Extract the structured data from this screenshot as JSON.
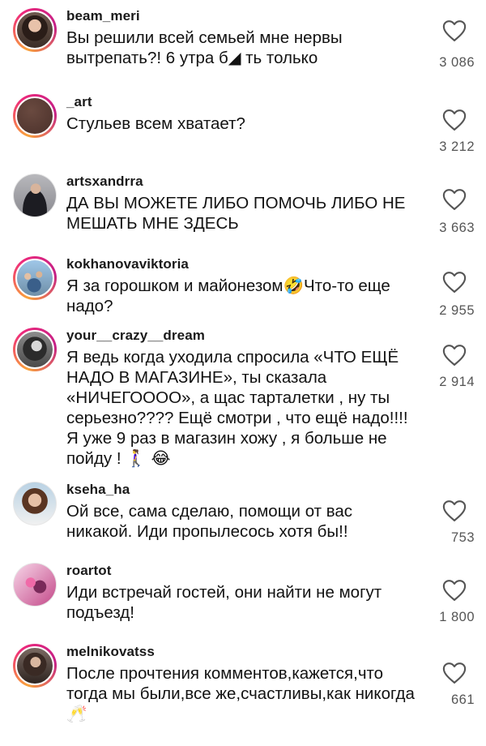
{
  "comments": [
    {
      "username": "beam_meri",
      "text": "Вы решили всей семьей мне нервы вытрепать?! 6 утра б⁠◢ ть только",
      "likes": "3 086",
      "avatar": "woman-dark-hair-avatar"
    },
    {
      "username": "_art",
      "text": "Стульев всем хватает?",
      "likes": "3 212",
      "avatar": "brown-circle-avatar"
    },
    {
      "username": "artsxandrra",
      "text": "ДА ВЫ МОЖЕТЕ ЛИБО ПОМОЧЬ ЛИБО НЕ МЕШАТЬ МНЕ ЗДЕСЬ",
      "likes": "3 663",
      "avatar": "man-in-suit-avatar"
    },
    {
      "username": "kokhanovaviktoria",
      "text": "Я за горошком и майонезом🤣Что-то еще надо?",
      "likes": "2 955",
      "avatar": "family-photo-avatar"
    },
    {
      "username": "your__crazy__dream",
      "text": "Я ведь когда уходила спросила «ЧТО ЕЩЁ НАДО В МАГАЗИНЕ», ты сказала «НИЧЕГОООО», а щас тарталетки , ну ты серьезно???? Ещё смотри , что ещё надо!!!! Я уже 9 раз в магазин хожу , я больше не пойду ! 🚶‍♀️ 😂",
      "likes": "2 914",
      "avatar": "woman-bw-avatar"
    },
    {
      "username": "kseha_ha",
      "text": "Ой все, сама сделаю, помощи от вас никакой. Иди пропылесось хотя бы!!",
      "likes": "753",
      "avatar": "smiling-woman-avatar"
    },
    {
      "username": "roartot",
      "text": "Иди встречай гостей, они найти не могут подъезд!",
      "likes": "1 800",
      "avatar": "pink-art-avatar"
    },
    {
      "username": "melnikovatss",
      "text": "После прочтения комментов,кажется,что тогда мы были,все же,счастливы,как никогда 🥂",
      "likes": "661",
      "avatar": "woman-portrait-avatar"
    }
  ]
}
